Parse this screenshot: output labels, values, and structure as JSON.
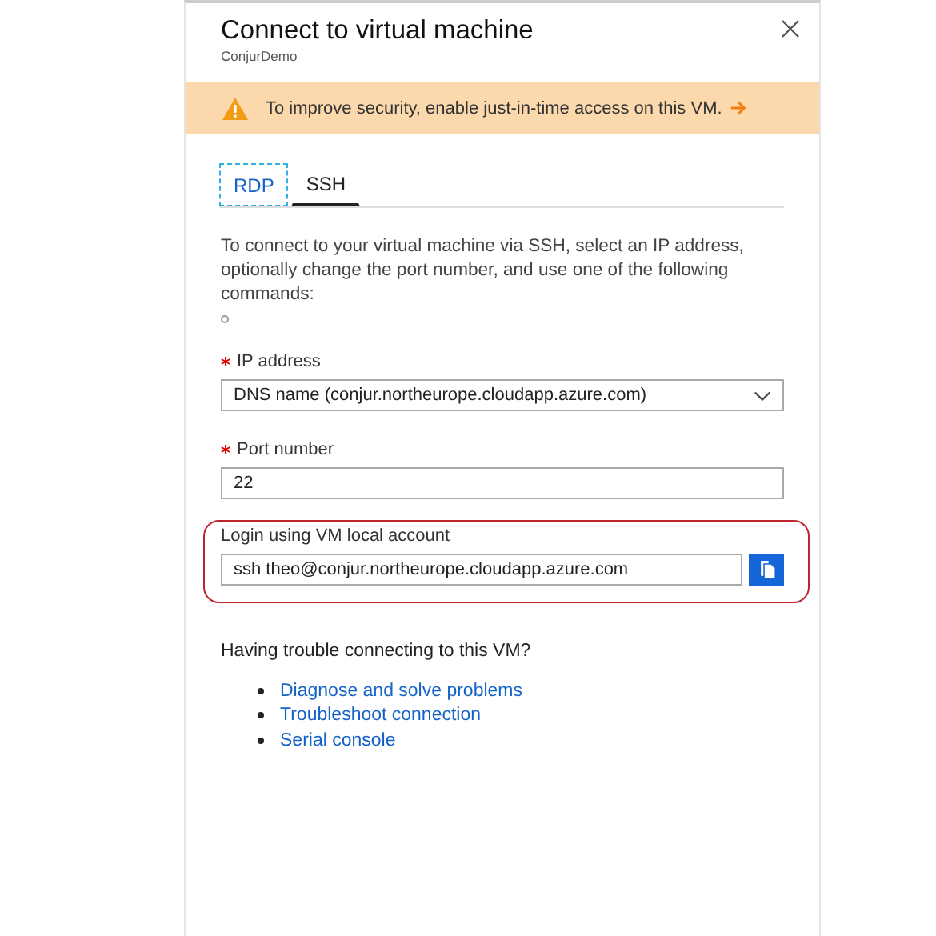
{
  "panel": {
    "title": "Connect to virtual machine",
    "subtitle": "ConjurDemo"
  },
  "banner": {
    "text": "To improve security, enable just-in-time access on this VM."
  },
  "tabs": [
    {
      "label": "RDP",
      "selected": false,
      "focused": true
    },
    {
      "label": "SSH",
      "selected": true,
      "focused": false
    }
  ],
  "intro": "To connect to your virtual machine via SSH, select an IP address, optionally change the port number, and use one of the following commands:",
  "fields": [
    {
      "kind": "select",
      "label": "IP address",
      "required": true,
      "value": "DNS name (conjur.northeurope.cloudapp.azure.com)"
    },
    {
      "kind": "text",
      "label": "Port number",
      "required": true,
      "value": "22"
    },
    {
      "kind": "copy",
      "label": "Login using VM local account",
      "required": false,
      "value": "ssh theo@conjur.northeurope.cloudapp.azure.com",
      "highlighted": true
    }
  ],
  "help": {
    "title": "Having trouble connecting to this VM?",
    "links": [
      "Diagnose and solve problems",
      "Troubleshoot connection",
      "Serial console"
    ]
  }
}
